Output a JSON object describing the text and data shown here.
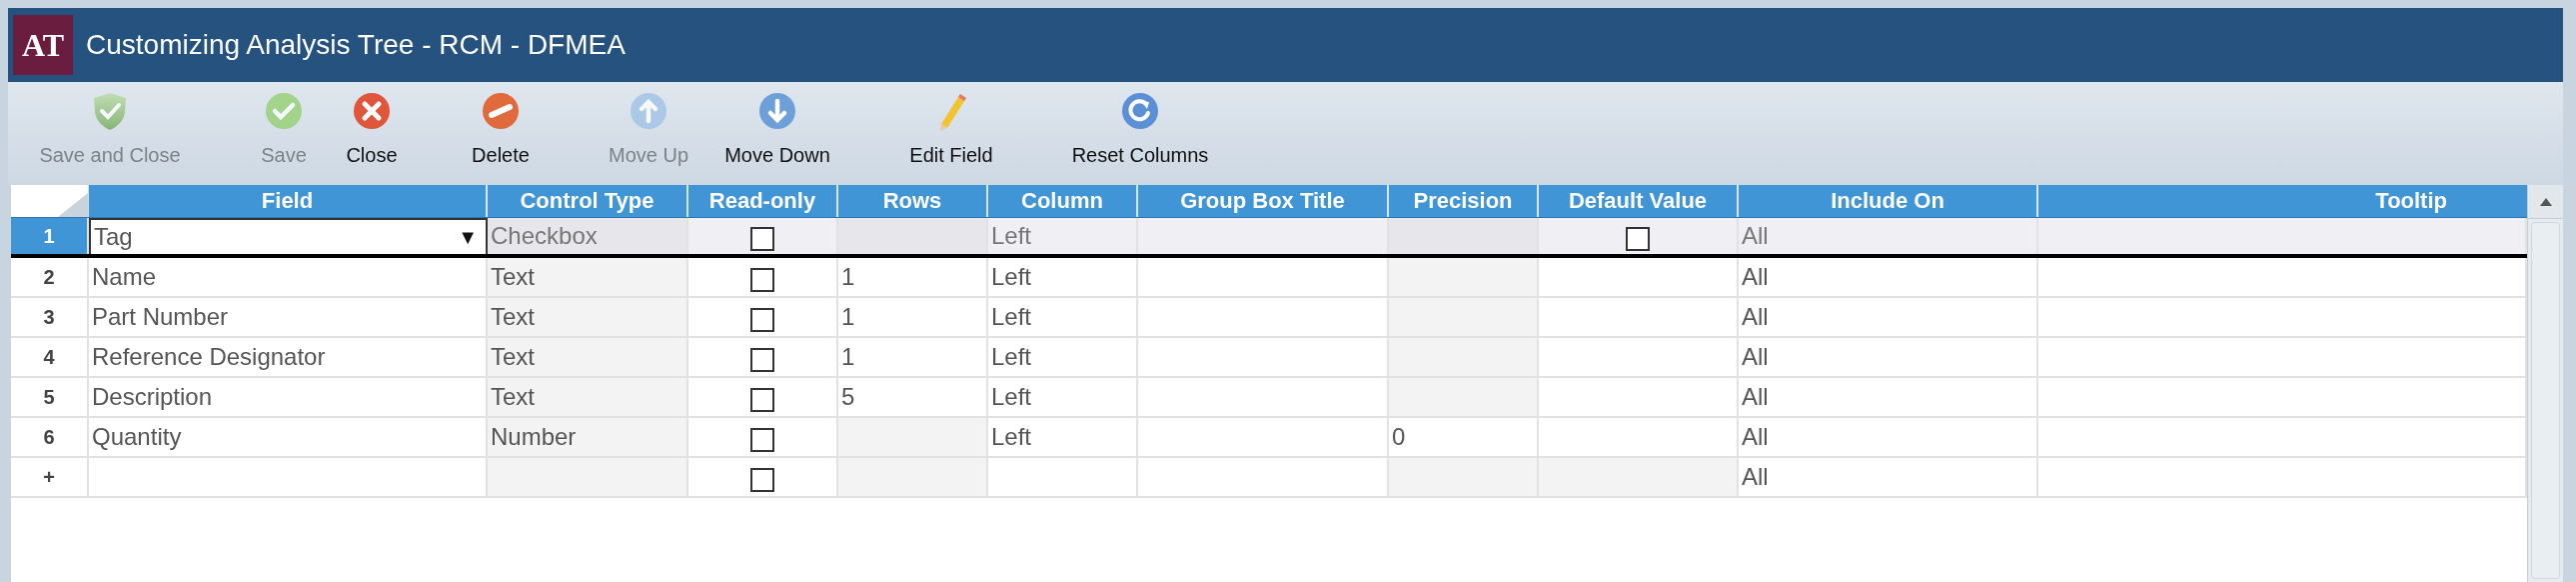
{
  "window": {
    "logo": "AT",
    "title": "Customizing Analysis Tree - RCM - DFMEA"
  },
  "toolbar": [
    {
      "kind": "save_close",
      "label": "Save and Close",
      "disabled": true
    },
    {
      "kind": "save",
      "label": "Save",
      "disabled": true
    },
    {
      "kind": "close",
      "label": "Close",
      "disabled": false
    },
    {
      "kind": "delete",
      "label": "Delete",
      "disabled": false
    },
    {
      "kind": "up",
      "label": "Move Up",
      "disabled": true
    },
    {
      "kind": "down",
      "label": "Move Down",
      "disabled": false
    },
    {
      "kind": "edit",
      "label": "Edit Field",
      "disabled": false
    },
    {
      "kind": "reset",
      "label": "Reset Columns",
      "disabled": false
    }
  ],
  "table": {
    "columns": [
      "Field",
      "Control Type",
      "Read-only",
      "Rows",
      "Column",
      "Group Box Title",
      "Precision",
      "Default Value",
      "Include On",
      "Tooltip"
    ],
    "rows": [
      {
        "number": "1",
        "selected": true,
        "cells": [
          {
            "kind": "dropdown",
            "text": "Tag",
            "arrow": "▼"
          },
          {
            "kind": "text",
            "text": "Checkbox",
            "disabled": true
          },
          {
            "kind": "checkbox",
            "checked": false
          },
          {
            "kind": "empty",
            "disabled": true
          },
          {
            "kind": "text",
            "text": "Left"
          },
          {
            "kind": "empty"
          },
          {
            "kind": "empty",
            "disabled": true
          },
          {
            "kind": "checkbox",
            "checked": false
          },
          {
            "kind": "text",
            "text": "All"
          },
          {
            "kind": "empty"
          }
        ]
      },
      {
        "number": "2",
        "selected": false,
        "cells": [
          {
            "kind": "text",
            "text": "Name"
          },
          {
            "kind": "text",
            "text": "Text",
            "disabled": true
          },
          {
            "kind": "checkbox",
            "checked": false
          },
          {
            "kind": "text",
            "text": "1"
          },
          {
            "kind": "text",
            "text": "Left"
          },
          {
            "kind": "empty"
          },
          {
            "kind": "empty",
            "disabled": true
          },
          {
            "kind": "empty"
          },
          {
            "kind": "text",
            "text": "All"
          },
          {
            "kind": "empty"
          }
        ]
      },
      {
        "number": "3",
        "selected": false,
        "cells": [
          {
            "kind": "text",
            "text": "Part Number"
          },
          {
            "kind": "text",
            "text": "Text",
            "disabled": true
          },
          {
            "kind": "checkbox",
            "checked": false
          },
          {
            "kind": "text",
            "text": "1"
          },
          {
            "kind": "text",
            "text": "Left"
          },
          {
            "kind": "empty"
          },
          {
            "kind": "empty",
            "disabled": true
          },
          {
            "kind": "empty"
          },
          {
            "kind": "text",
            "text": "All"
          },
          {
            "kind": "empty"
          }
        ]
      },
      {
        "number": "4",
        "selected": false,
        "cells": [
          {
            "kind": "text",
            "text": "Reference Designator"
          },
          {
            "kind": "text",
            "text": "Text",
            "disabled": true
          },
          {
            "kind": "checkbox",
            "checked": false
          },
          {
            "kind": "text",
            "text": "1"
          },
          {
            "kind": "text",
            "text": "Left"
          },
          {
            "kind": "empty"
          },
          {
            "kind": "empty",
            "disabled": true
          },
          {
            "kind": "empty"
          },
          {
            "kind": "text",
            "text": "All"
          },
          {
            "kind": "empty"
          }
        ]
      },
      {
        "number": "5",
        "selected": false,
        "cells": [
          {
            "kind": "text",
            "text": "Description"
          },
          {
            "kind": "text",
            "text": "Text",
            "disabled": true
          },
          {
            "kind": "checkbox",
            "checked": false
          },
          {
            "kind": "text",
            "text": "5"
          },
          {
            "kind": "text",
            "text": "Left"
          },
          {
            "kind": "empty"
          },
          {
            "kind": "empty",
            "disabled": true
          },
          {
            "kind": "empty"
          },
          {
            "kind": "text",
            "text": "All"
          },
          {
            "kind": "empty"
          }
        ]
      },
      {
        "number": "6",
        "selected": false,
        "cells": [
          {
            "kind": "text",
            "text": "Quantity"
          },
          {
            "kind": "text",
            "text": "Number",
            "disabled": true
          },
          {
            "kind": "checkbox",
            "checked": false
          },
          {
            "kind": "empty",
            "disabled": true
          },
          {
            "kind": "text",
            "text": "Left"
          },
          {
            "kind": "empty"
          },
          {
            "kind": "text",
            "text": "0"
          },
          {
            "kind": "empty"
          },
          {
            "kind": "text",
            "text": "All"
          },
          {
            "kind": "empty"
          }
        ]
      },
      {
        "number": "+",
        "selected": false,
        "cells": [
          {
            "kind": "empty"
          },
          {
            "kind": "empty",
            "disabled": true
          },
          {
            "kind": "checkbox",
            "checked": false
          },
          {
            "kind": "empty",
            "disabled": true
          },
          {
            "kind": "empty"
          },
          {
            "kind": "empty"
          },
          {
            "kind": "empty",
            "disabled": true
          },
          {
            "kind": "empty",
            "disabled": true
          },
          {
            "kind": "text",
            "text": "All"
          },
          {
            "kind": "empty"
          }
        ]
      }
    ]
  }
}
